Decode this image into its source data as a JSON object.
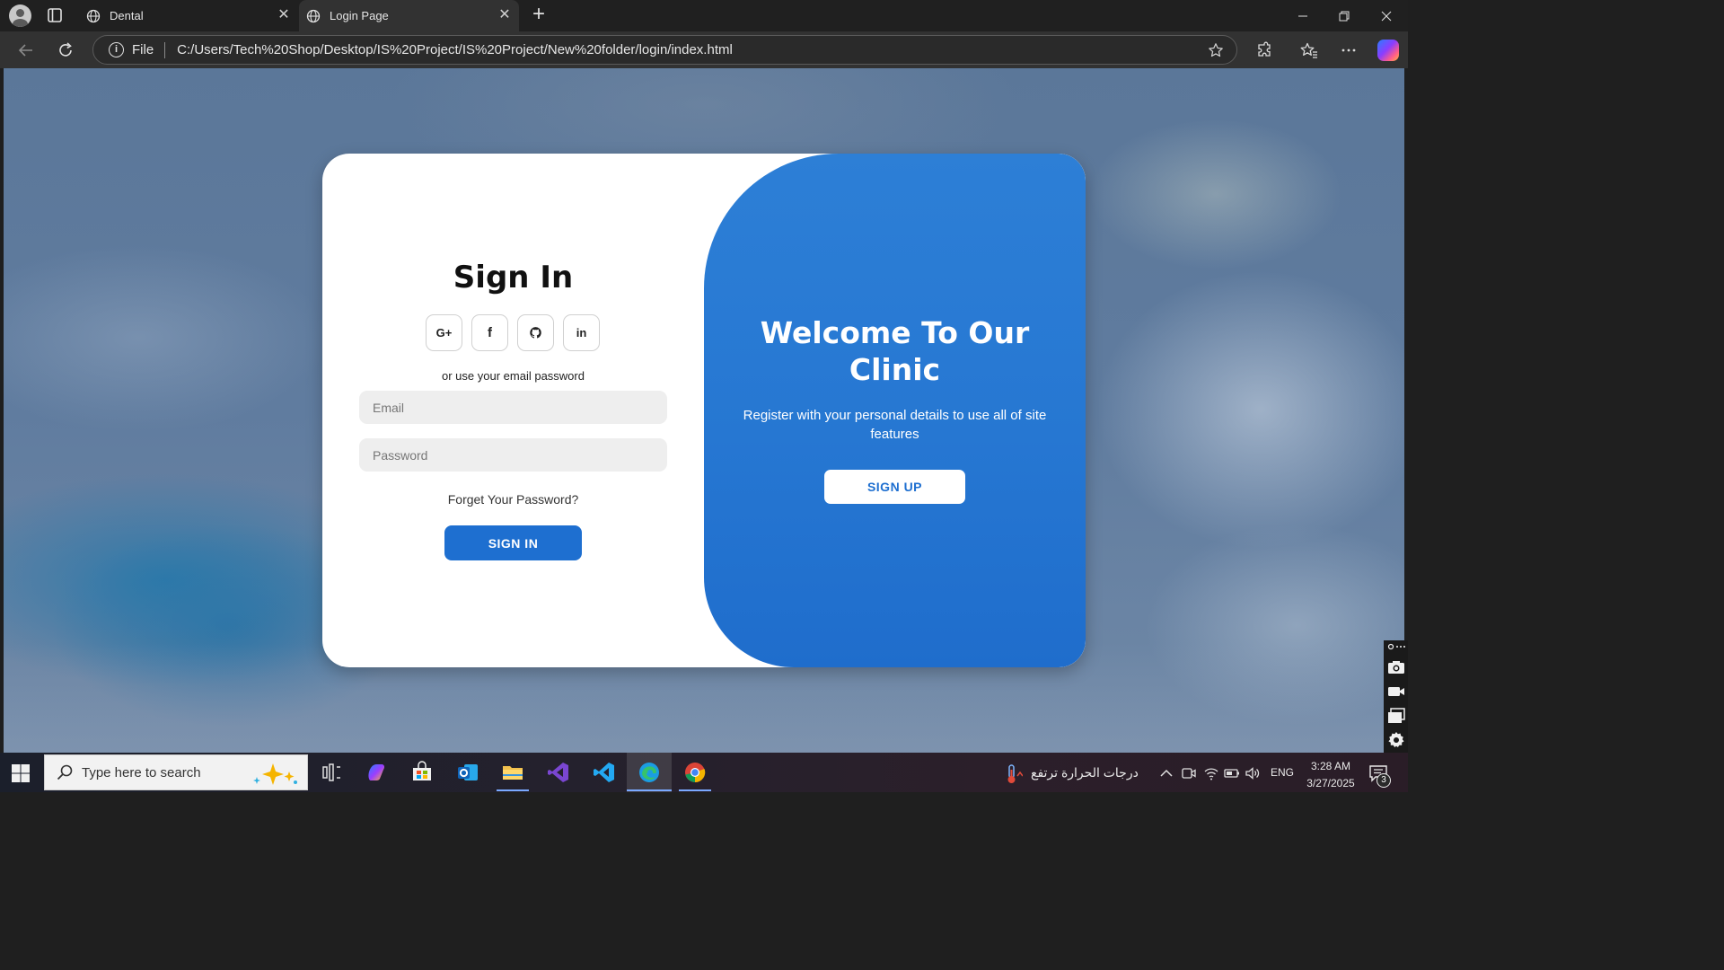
{
  "browser": {
    "tabs": [
      {
        "title": "Dental",
        "icon": "globe-icon",
        "active": false
      },
      {
        "title": "Login Page",
        "icon": "globe-icon",
        "active": true
      }
    ],
    "address": {
      "scheme_label": "File",
      "url": "C:/Users/Tech%20Shop/Desktop/IS%20Project/IS%20Project/New%20folder/login/index.html"
    }
  },
  "page": {
    "signin": {
      "title": "Sign In",
      "social_buttons": [
        "G+",
        "f",
        "github",
        "in"
      ],
      "hint": "or use your email password",
      "email_placeholder": "Email",
      "password_placeholder": "Password",
      "forgot_link": "Forget Your Password?",
      "submit_label": "SIGN IN"
    },
    "welcome": {
      "title": "Welcome To Our Clinic",
      "text": "Register with your personal details to use all of site features",
      "signup_label": "SIGN UP"
    },
    "colors": {
      "accent": "#1e6fd0",
      "panel": "#2677d2"
    }
  },
  "taskbar": {
    "search_placeholder": "Type here to search",
    "weather_text": "درجات الحرارة ترتفع",
    "language": "ENG",
    "time": "3:28 AM",
    "date": "3/27/2025",
    "notification_count": "3",
    "apps": [
      "task-view",
      "copilot",
      "microsoft-store",
      "outlook",
      "file-explorer",
      "visual-studio",
      "vs-code",
      "edge",
      "chrome"
    ]
  }
}
